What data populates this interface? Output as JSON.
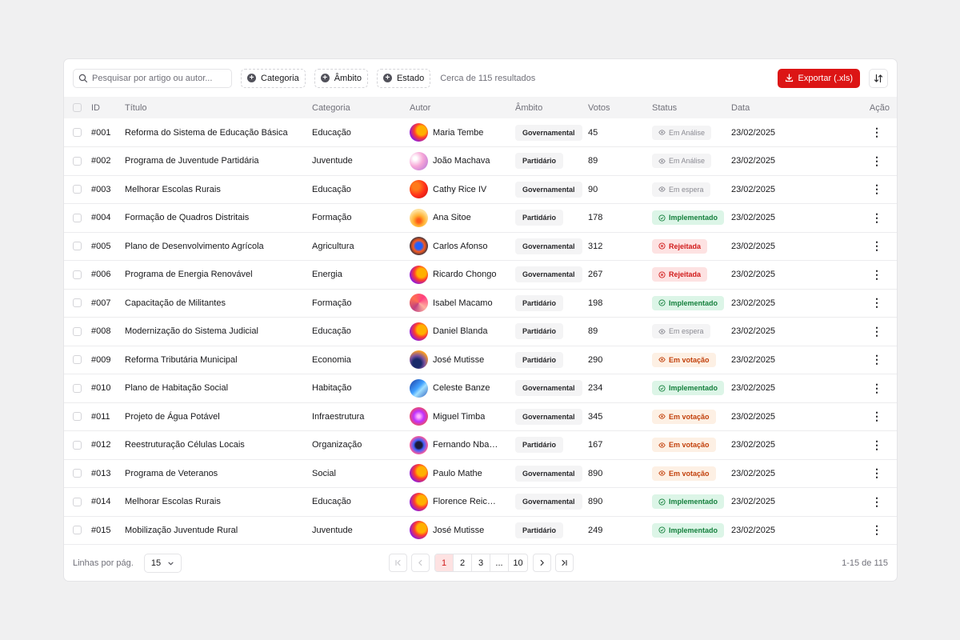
{
  "toolbar": {
    "search_placeholder": "Pesquisar por artigo ou autor...",
    "filters": [
      "Categoria",
      "Âmbito",
      "Estado"
    ],
    "results_text": "Cerca de 115 resultados",
    "export_label": "Exportar (.xls)"
  },
  "columns": [
    "ID",
    "Título",
    "Categoria",
    "Autor",
    "Âmbito",
    "Votos",
    "Status",
    "Data",
    "Ação"
  ],
  "rows": [
    {
      "id": "#001",
      "title": "Reforma do Sistema de Educação Básica",
      "category": "Educação",
      "author": "Maria Tembe",
      "scope": "Governamental",
      "votes": "45",
      "status": "Em Análise",
      "status_kind": "analise",
      "date": "23/02/2025",
      "avatar": "a1"
    },
    {
      "id": "#002",
      "title": "Programa de Juventude Partidária",
      "category": "Juventude",
      "author": "João Machava",
      "scope": "Partidário",
      "votes": "89",
      "status": "Em Análise",
      "status_kind": "analise",
      "date": "23/02/2025",
      "avatar": "a2"
    },
    {
      "id": "#003",
      "title": "Melhorar Escolas Rurais",
      "category": "Educação",
      "author": "Cathy Rice IV",
      "scope": "Governamental",
      "votes": "90",
      "status": "Em espera",
      "status_kind": "espera",
      "date": "23/02/2025",
      "avatar": "a3"
    },
    {
      "id": "#004",
      "title": "Formação de Quadros Distritais",
      "category": "Formação",
      "author": "Ana Sitoe",
      "scope": "Partidário",
      "votes": "178",
      "status": "Implementado",
      "status_kind": "impl",
      "date": "23/02/2025",
      "avatar": "a4"
    },
    {
      "id": "#005",
      "title": "Plano de Desenvolvimento Agrícola",
      "category": "Agricultura",
      "author": "Carlos Afonso",
      "scope": "Governamental",
      "votes": "312",
      "status": "Rejeitada",
      "status_kind": "rej",
      "date": "23/02/2025",
      "avatar": "a5"
    },
    {
      "id": "#006",
      "title": "Programa de Energia Renovável",
      "category": "Energia",
      "author": "Ricardo Chongo",
      "scope": "Governamental",
      "votes": "267",
      "status": "Rejeitada",
      "status_kind": "rej",
      "date": "23/02/2025",
      "avatar": "a1"
    },
    {
      "id": "#007",
      "title": "Capacitação de Militantes",
      "category": "Formação",
      "author": "Isabel Macamo",
      "scope": "Partidário",
      "votes": "198",
      "status": "Implementado",
      "status_kind": "impl",
      "date": "23/02/2025",
      "avatar": "a6"
    },
    {
      "id": "#008",
      "title": "Modernização do Sistema Judicial",
      "category": "Educação",
      "author": "Daniel Blanda",
      "scope": "Partidário",
      "votes": "89",
      "status": "Em espera",
      "status_kind": "espera",
      "date": "23/02/2025",
      "avatar": "a1"
    },
    {
      "id": "#009",
      "title": "Reforma Tributária Municipal",
      "category": "Economia",
      "author": "José Mutisse",
      "scope": "Partidário",
      "votes": "290",
      "status": "Em votação",
      "status_kind": "vot",
      "date": "23/02/2025",
      "avatar": "a7"
    },
    {
      "id": "#010",
      "title": "Plano de Habitação Social",
      "category": "Habitação",
      "author": "Celeste Banze",
      "scope": "Governamental",
      "votes": "234",
      "status": "Implementado",
      "status_kind": "impl",
      "date": "23/02/2025",
      "avatar": "a8"
    },
    {
      "id": "#011",
      "title": "Projeto de Água Potável",
      "category": "Infraestrutura",
      "author": "Miguel Timba",
      "scope": "Governamental",
      "votes": "345",
      "status": "Em votação",
      "status_kind": "vot",
      "date": "23/02/2025",
      "avatar": "a9"
    },
    {
      "id": "#012",
      "title": "Reestruturação Células Locais",
      "category": "Organização",
      "author": "Fernando Nbambe",
      "scope": "Partidário",
      "votes": "167",
      "status": "Em votação",
      "status_kind": "vot",
      "date": "23/02/2025",
      "avatar": "a10"
    },
    {
      "id": "#013",
      "title": "Programa de Veteranos",
      "category": "Social",
      "author": "Paulo Mathe",
      "scope": "Governamental",
      "votes": "890",
      "status": "Em votação",
      "status_kind": "vot",
      "date": "23/02/2025",
      "avatar": "a1"
    },
    {
      "id": "#014",
      "title": "Melhorar Escolas Rurais",
      "category": "Educação",
      "author": "Florence Reichert",
      "scope": "Governamental",
      "votes": "890",
      "status": "Implementado",
      "status_kind": "impl",
      "date": "23/02/2025",
      "avatar": "a1"
    },
    {
      "id": "#015",
      "title": "Mobilização Juventude Rural",
      "category": "Juventude",
      "author": "José Mutisse",
      "scope": "Partidário",
      "votes": "249",
      "status": "Implementado",
      "status_kind": "impl",
      "date": "23/02/2025",
      "avatar": "a1"
    }
  ],
  "footer": {
    "rows_label": "Linhas por pág.",
    "rows_value": "15",
    "pages": [
      "1",
      "2",
      "3",
      "...",
      "10"
    ],
    "active_page": "1",
    "count_text": "1-15 de 115"
  },
  "colors": {
    "accent": "#dc1515",
    "implemented": "#15803d",
    "rejected": "#d11a1a",
    "voting": "#c2410c"
  }
}
